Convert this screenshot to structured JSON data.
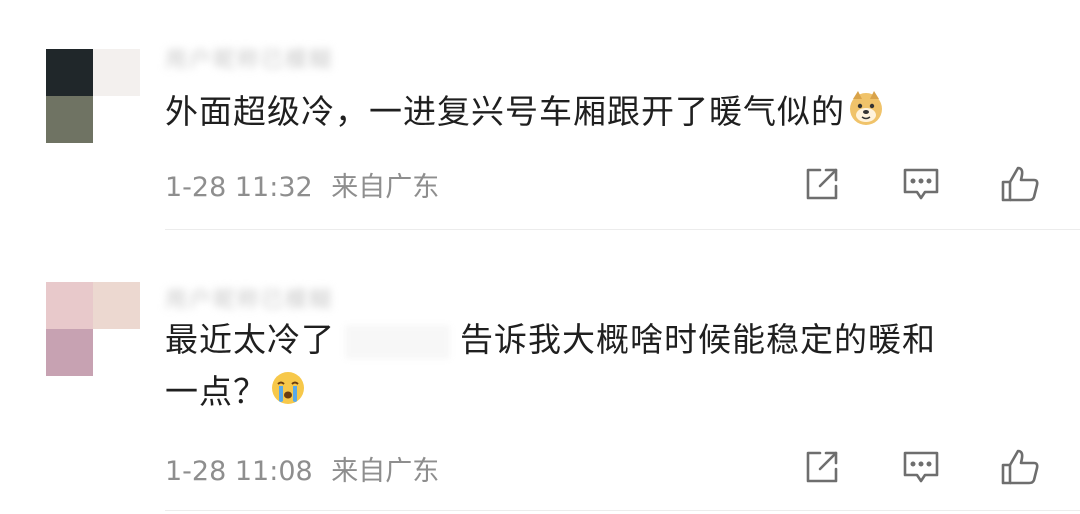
{
  "comments": [
    {
      "username": "用户昵称已模糊",
      "text_before": "外面超级冷，一进复兴号车厢跟开了暖气似的",
      "emoji": "doge-emoji",
      "time": "1-28 11:32",
      "location": "来自广东",
      "avatar_colors": [
        "#20272a",
        "#f3f0ee",
        "#6f7363",
        "#ffffff"
      ]
    },
    {
      "username": "用户昵称已模糊",
      "text_before": "最近太冷了",
      "text_after": "告诉我大概啥时候能稳定的暖和",
      "text_line2": "一点？",
      "emoji": "crying-emoji",
      "time": "1-28 11:08",
      "location": "来自广东",
      "avatar_colors": [
        "#e8c9cb",
        "#ecd8d0",
        "#c7a2b2",
        "#ffffff"
      ]
    }
  ],
  "icons": [
    "share-icon",
    "comment-icon",
    "like-icon"
  ],
  "colors": {
    "meta_gray": "#8e8e8e",
    "icon_gray": "#6e6e6e"
  }
}
